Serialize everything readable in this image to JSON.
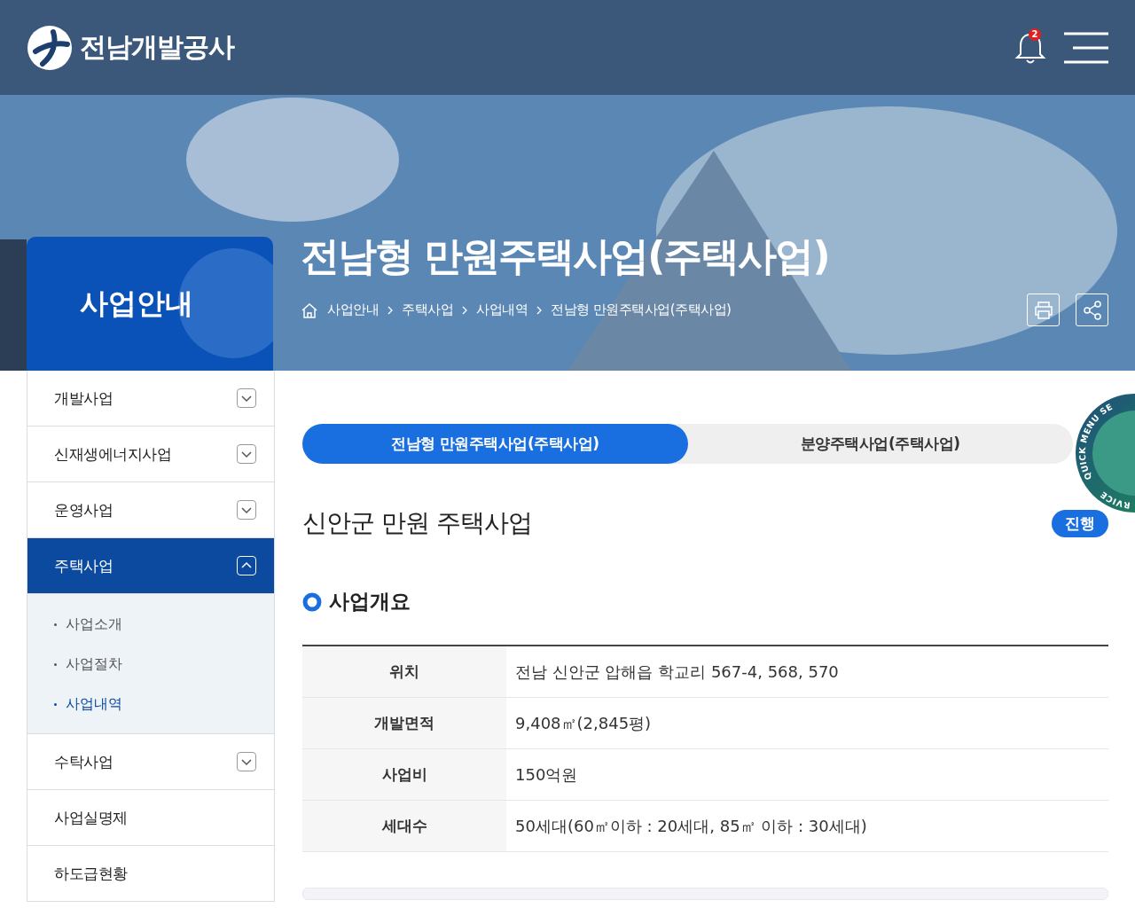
{
  "header": {
    "logo_text": "전남개발공사",
    "notification_count": "2"
  },
  "hero": {
    "section_title": "사업안내",
    "page_title": "전남형 만원주택사업(주택사업)",
    "breadcrumb": [
      "사업안내",
      "주택사업",
      "사업내역",
      "전남형 만원주택사업(주택사업)"
    ]
  },
  "sidebar": {
    "items": [
      {
        "label": "개발사업",
        "kind": "group",
        "expanded": false,
        "selected": false
      },
      {
        "label": "신재생에너지사업",
        "kind": "group",
        "expanded": false,
        "selected": false
      },
      {
        "label": "운영사업",
        "kind": "group",
        "expanded": false,
        "selected": false
      },
      {
        "label": "주택사업",
        "kind": "group",
        "expanded": true,
        "selected": true,
        "children": [
          {
            "label": "사업소개",
            "selected": false
          },
          {
            "label": "사업절차",
            "selected": false
          },
          {
            "label": "사업내역",
            "selected": true
          }
        ]
      },
      {
        "label": "수탁사업",
        "kind": "group",
        "expanded": false,
        "selected": false
      },
      {
        "label": "사업실명제",
        "kind": "link",
        "selected": false
      },
      {
        "label": "하도급현황",
        "kind": "link",
        "selected": false
      }
    ]
  },
  "tabs": [
    {
      "label": "전남형 만원주택사업(주택사업)",
      "selected": true
    },
    {
      "label": "분양주택사업(주택사업)",
      "selected": false
    }
  ],
  "quick_menu": {
    "label_top": "QUICK MENU SE",
    "label_bottom": "RVICE"
  },
  "project": {
    "title": "신안군 만원 주택사업",
    "status": "진행"
  },
  "overview": {
    "heading": "사업개요",
    "rows": [
      {
        "label": "위치",
        "value": "전남 신안군 압해읍 학교리 567-4, 568, 570"
      },
      {
        "label": "개발면적",
        "value": "9,408㎡(2,845평)"
      },
      {
        "label": "사업비",
        "value": "150억원"
      },
      {
        "label": "세대수",
        "value": "50세대(60㎡이하 : 20세대, 85㎡ 이하 : 30세대)"
      }
    ]
  }
}
